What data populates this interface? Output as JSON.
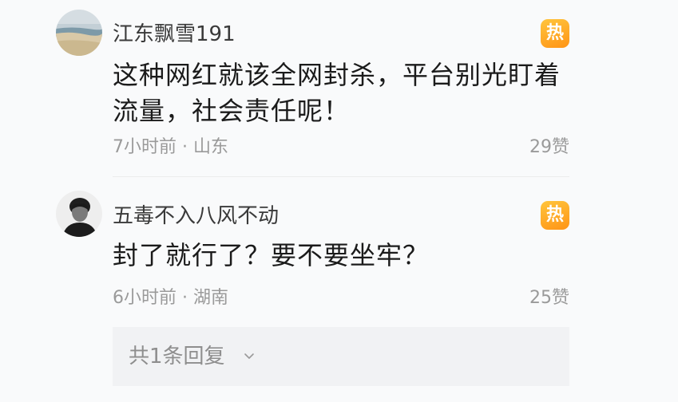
{
  "comments": [
    {
      "username": "江东飘雪191",
      "badge": "热",
      "content": "这种网红就该全网封杀，平台别光盯着流量，社会责任呢！",
      "meta": "7小时前 · 山东",
      "likes": "29赞",
      "avatar": "beach-landscape-avatar"
    },
    {
      "username": "五毒不入八风不动",
      "badge": "热",
      "content": "封了就行了？要不要坐牢？",
      "meta": "6小时前 · 湖南",
      "likes": "25赞",
      "avatar": "portrait-photo-avatar",
      "replies_label": "共1条回复",
      "replies_icon": "chevron-down-icon"
    }
  ],
  "colors": {
    "hot_badge_top": "#ffc53d",
    "hot_badge_bottom": "#ff9416",
    "meta_text": "#9a9a9a",
    "content_text": "#1b1b1b",
    "replies_bg": "#f1f2f4"
  }
}
